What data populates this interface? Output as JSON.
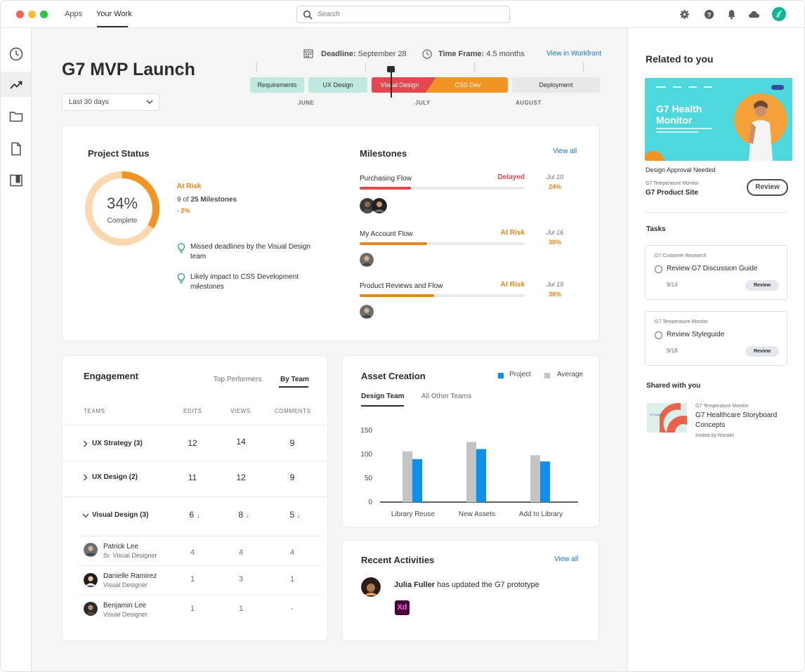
{
  "topbar": {
    "nav": [
      "Apps",
      "Your Work"
    ],
    "search_placeholder": "Search"
  },
  "header": {
    "title": "G7 MVP Launch",
    "range": "Last 30 days",
    "deadline_label": "Deadline:",
    "deadline_value": "September 28",
    "timeframe_label": "Time Frame:",
    "timeframe_value": "4.5 months",
    "view_workfront": "View in Workfront"
  },
  "timeline": {
    "phases": [
      {
        "label": "Requirements",
        "color": "#bfe8de",
        "text": "#2c2c2c"
      },
      {
        "label": "UX Design",
        "color": "#bfe8de",
        "text": "#2c2c2c"
      },
      {
        "label": "Visual Design",
        "color": "#e34850",
        "text": "#ffffff"
      },
      {
        "label": "CSS Dev",
        "color": "#f29423",
        "text": "#ffffff"
      },
      {
        "label": "Deployment",
        "color": "#e8e8e8",
        "text": "#2c2c2c"
      }
    ],
    "months": [
      "JUNE",
      "JULY",
      "AUGUST"
    ]
  },
  "project_status": {
    "title": "Project Status",
    "percent": 34,
    "percent_label": "34%",
    "complete_label": "Complete",
    "risk": "At Risk",
    "milestones_of": "9 of",
    "milestones_total": "25 Milestones",
    "delta": "- 2%",
    "insights": [
      "Missed deadlines by the Visual Design team",
      "Likely impact to CSS Development milestones"
    ]
  },
  "milestones": {
    "title": "Milestones",
    "view_all": "View all",
    "items": [
      {
        "name": "Purchasing Flow",
        "status": "Delayed",
        "status_color": "#e34850",
        "date": "Jul 10",
        "pct": "24%",
        "progress": 0.31,
        "fill_color": "#e34850"
      },
      {
        "name": "My Account Flow",
        "status": "At Risk",
        "status_color": "#e68619",
        "date": "Jul 16",
        "pct": "30%",
        "progress": 0.41,
        "fill_color": "#e68619"
      },
      {
        "name": "Product Reviews and Flow",
        "status": "At Risk",
        "status_color": "#e68619",
        "date": "Jul 19",
        "pct": "38%",
        "progress": 0.45,
        "fill_color": "#e68619"
      }
    ]
  },
  "engagement": {
    "title": "Engagement",
    "tabs": [
      "Top Performers",
      "By Team"
    ],
    "headers": [
      "TEAMS",
      "EDITS",
      "VIEWS",
      "COMMENTS"
    ],
    "teams": [
      {
        "name": "UX Strategy (3)",
        "edits": "12",
        "views": "14",
        "comments": "9"
      },
      {
        "name": "UX Design (2)",
        "edits": "11",
        "views": "12",
        "comments": "9"
      },
      {
        "name": "Visual Design (3)",
        "edits": "6",
        "views": "8",
        "comments": "5",
        "arrow": "↓"
      }
    ],
    "members": [
      {
        "name": "Patrick Lee",
        "role": "Sr. Visual Designer",
        "edits": "4",
        "views": "4",
        "comments": "4"
      },
      {
        "name": "Danielle Ramirez",
        "role": "Visual Designer",
        "edits": "1",
        "views": "3",
        "comments": "1"
      },
      {
        "name": "Benjamin Lee",
        "role": "Visual Designer",
        "edits": "1",
        "views": "1",
        "comments": "-"
      }
    ]
  },
  "asset_creation": {
    "title": "Asset Creation",
    "tabs": [
      "Design Team",
      "All Other Teams"
    ]
  },
  "chart_data": {
    "type": "bar",
    "categories": [
      "Library Reuse",
      "New Assets",
      "Add to Library"
    ],
    "series": [
      {
        "name": "Project",
        "values": [
          90,
          111,
          85
        ],
        "color": "#0d8ff0"
      },
      {
        "name": "Average",
        "values": [
          106,
          126,
          98
        ],
        "color": "#c4c4c4"
      }
    ],
    "yticks": [
      0,
      50,
      100,
      150
    ],
    "ylim": [
      0,
      150
    ],
    "legend": "top-right",
    "grid": false
  },
  "recent": {
    "title": "Recent Activities",
    "view_all": "View all",
    "actor": "Julia Fuller",
    "action": "has updated the G7 prototype",
    "app_badge": "Xd"
  },
  "related": {
    "title": "Related to you",
    "promo_title": "G7 Health Monitor",
    "approval": "Design Approval Needed",
    "source": "G7 Temperature Monitor",
    "site": "G7 Product Site",
    "review": "Review"
  },
  "tasks": {
    "title": "Tasks",
    "items": [
      {
        "source": "G7 Customer Research",
        "name": "Review G7 Discussion Guide",
        "date": "9/14",
        "button": "Review"
      },
      {
        "source": "G7 Temperature Monitor",
        "name": "Review Styleguide",
        "date": "9/18",
        "button": "Review"
      }
    ]
  },
  "shared": {
    "title": "Shared with you",
    "source": "G7 Temperature Monitor",
    "name_line1": "G7 Healthcare Storyboard",
    "name_line2": "Concepts",
    "invited": "Invited by Ronald",
    "thumb_text": "G7 Monitor"
  }
}
